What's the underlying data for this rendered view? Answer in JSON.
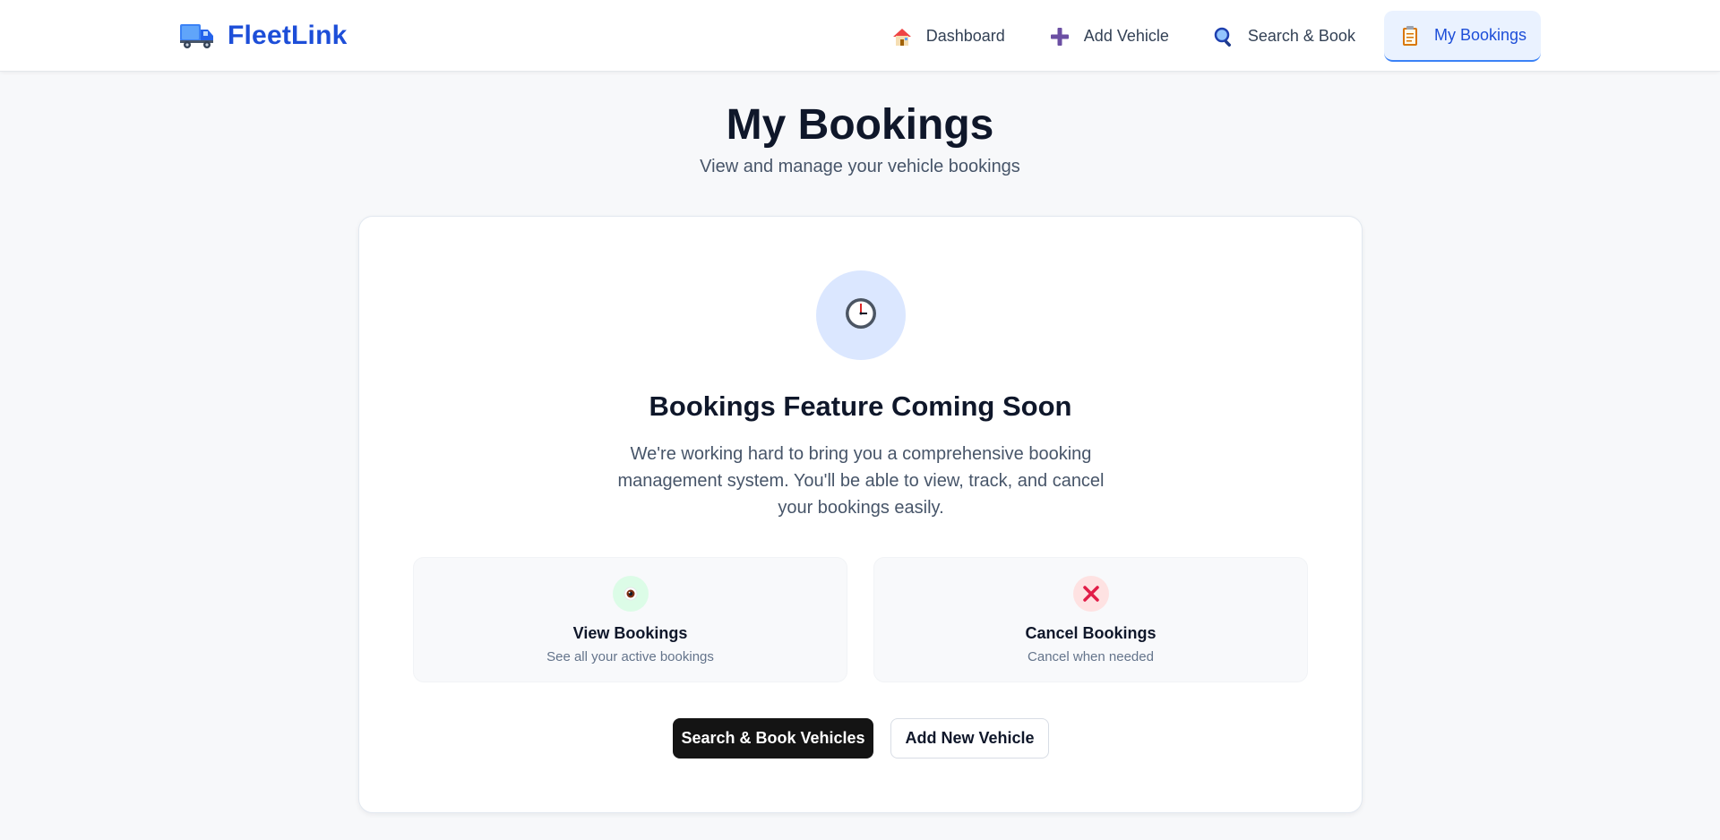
{
  "brand": {
    "name": "FleetLink",
    "icon": "truck-icon"
  },
  "nav": {
    "items": [
      {
        "label": "Dashboard",
        "icon": "house-icon",
        "active": false
      },
      {
        "label": "Add Vehicle",
        "icon": "plus-icon",
        "active": false
      },
      {
        "label": "Search & Book",
        "icon": "magnifier-icon",
        "active": false
      },
      {
        "label": "My Bookings",
        "icon": "clipboard-icon",
        "active": true
      }
    ]
  },
  "page": {
    "title": "My Bookings",
    "subtitle": "View and manage your vehicle bookings"
  },
  "card": {
    "icon": "clock-icon",
    "title": "Bookings Feature Coming Soon",
    "description": "We're working hard to bring you a comprehensive booking management system. You'll be able to view, track, and cancel your bookings easily.",
    "features": [
      {
        "title": "View Bookings",
        "description": "See all your active bookings",
        "icon": "eye-icon"
      },
      {
        "title": "Cancel Bookings",
        "description": "Cancel when needed",
        "icon": "cross-icon"
      }
    ],
    "buttons": {
      "primary": "Search & Book Vehicles",
      "secondary": "Add New Vehicle"
    }
  },
  "colors": {
    "brand": "#1d4ed8",
    "accent_bg": "#eaf2ff",
    "primary_button": "#141414",
    "background": "#f7f8fa"
  }
}
